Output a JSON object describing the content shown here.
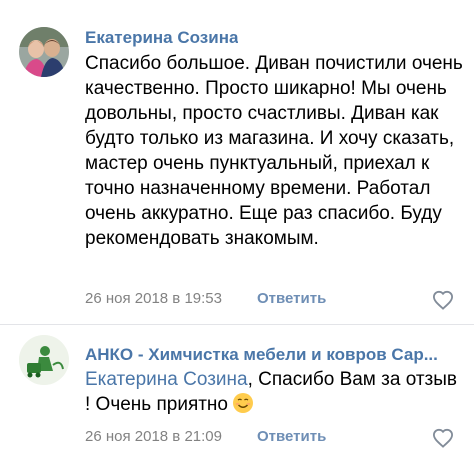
{
  "comments": [
    {
      "author": "Екатерина Созина",
      "text": "Спасибо большое. Диван почистили очень качественно. Просто шикарно! Мы очень довольны, просто счастливы. Диван как будто только из магазина. И хочу сказать, мастер очень пунктуальный, приехал к точно назначенному времени. Работал очень аккуратно. Еще раз спасибо. Буду рекомендовать знакомым.",
      "date": "26 ноя 2018 в 19:53",
      "reply_label": "Ответить"
    },
    {
      "author": "АНКО - Химчистка мебели и ковров Сар...",
      "mention": "Екатерина Созина",
      "text": ", Спасибо Вам за отзыв ! Очень приятно",
      "emoji": "smiling-face-icon",
      "date": "26 ноя 2018 в 21:09",
      "reply_label": "Ответить"
    }
  ],
  "colors": {
    "link": "#4a76a8",
    "meta": "#828282",
    "reply": "#6e8eb5",
    "divider": "#e3e4e8"
  }
}
